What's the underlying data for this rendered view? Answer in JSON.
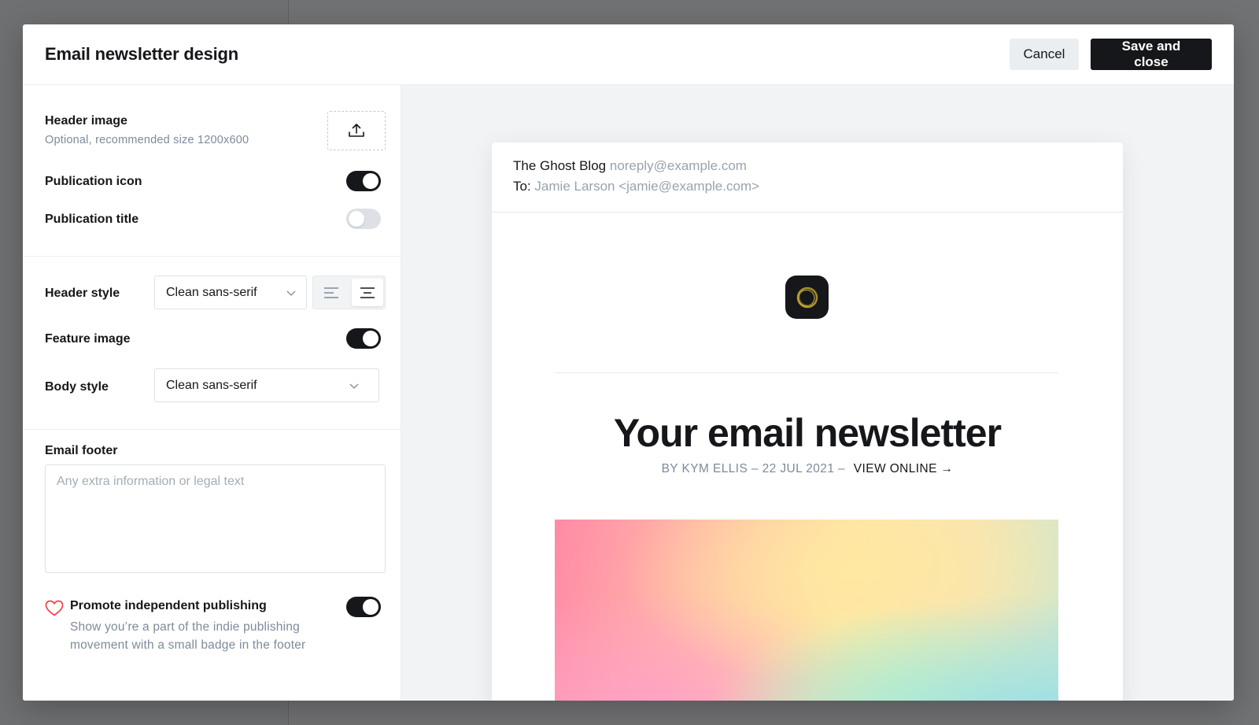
{
  "modal": {
    "title": "Email newsletter design",
    "cancel_label": "Cancel",
    "save_label": "Save and close"
  },
  "settings": {
    "header_image": {
      "label": "Header image",
      "hint": "Optional, recommended size 1200x600",
      "icon": "upload-icon"
    },
    "publication_icon": {
      "label": "Publication icon",
      "enabled": true
    },
    "publication_title": {
      "label": "Publication title",
      "enabled": false
    },
    "header_style": {
      "label": "Header style",
      "value": "Clean sans-serif",
      "alignment": "center"
    },
    "feature_image": {
      "label": "Feature image",
      "enabled": true
    },
    "body_style": {
      "label": "Body style",
      "value": "Clean sans-serif"
    },
    "email_footer": {
      "label": "Email footer",
      "placeholder": "Any extra information or legal text",
      "value": ""
    },
    "promote": {
      "label": "Promote independent publishing",
      "hint": "Show you’re a part of the indie publishing movement with a small badge in the footer",
      "enabled": true,
      "icon": "heart-icon"
    }
  },
  "preview": {
    "from_name": "The Ghost Blog",
    "from_email": "noreply@example.com",
    "to_prefix": "To:",
    "to_value": "Jamie Larson <jamie@example.com>",
    "title": "Your email newsletter",
    "byline": "BY KYM ELLIS – 22 JUL 2021 –",
    "view_online": "VIEW ONLINE →"
  },
  "colors": {
    "accent": "#15171a",
    "toggle_off": "#dde1e5",
    "heart": "#f5414a",
    "muted": "#7c8b9a"
  }
}
